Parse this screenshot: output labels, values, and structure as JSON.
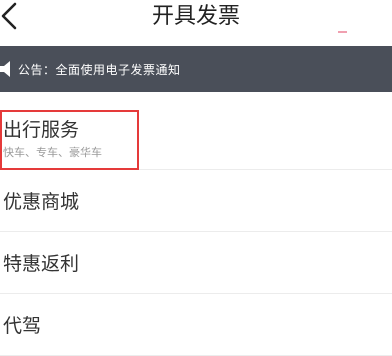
{
  "nav": {
    "title": "开具发票"
  },
  "notice": {
    "text": "公告：全面使用电子发票通知"
  },
  "menu": {
    "items": [
      {
        "label": "出行服务",
        "sub": "快车、专车、豪华车"
      },
      {
        "label": "优惠商城"
      },
      {
        "label": "特惠返利"
      },
      {
        "label": "代驾"
      }
    ]
  },
  "colors": {
    "notice_bg": "#4a4f59",
    "highlight": "#e53a3a",
    "divider": "#ececec"
  },
  "icons": {
    "back": "chevron-left-icon",
    "notice": "speaker-icon"
  }
}
